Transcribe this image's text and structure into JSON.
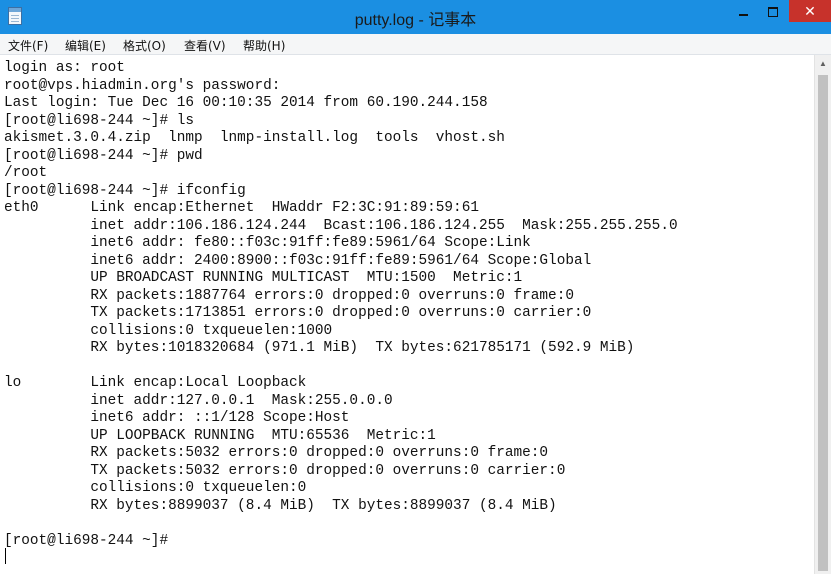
{
  "window": {
    "title": "putty.log - 记事本",
    "minimize_glyph": "",
    "maximize_glyph": "",
    "close_glyph": "✕",
    "accent_color": "#1b8fe2",
    "close_color": "#c7322b"
  },
  "menubar": {
    "items": [
      {
        "label": "文件(F)"
      },
      {
        "label": "编辑(E)"
      },
      {
        "label": "格式(O)"
      },
      {
        "label": "查看(V)"
      },
      {
        "label": "帮助(H)"
      }
    ]
  },
  "editor": {
    "lines": [
      "login as: root",
      "root@vps.hiadmin.org's password:",
      "Last login: Tue Dec 16 00:10:35 2014 from 60.190.244.158",
      "[root@li698-244 ~]# ls",
      "akismet.3.0.4.zip  lnmp  lnmp-install.log  tools  vhost.sh",
      "[root@li698-244 ~]# pwd",
      "/root",
      "[root@li698-244 ~]# ifconfig",
      "eth0      Link encap:Ethernet  HWaddr F2:3C:91:89:59:61",
      "          inet addr:106.186.124.244  Bcast:106.186.124.255  Mask:255.255.255.0",
      "          inet6 addr: fe80::f03c:91ff:fe89:5961/64 Scope:Link",
      "          inet6 addr: 2400:8900::f03c:91ff:fe89:5961/64 Scope:Global",
      "          UP BROADCAST RUNNING MULTICAST  MTU:1500  Metric:1",
      "          RX packets:1887764 errors:0 dropped:0 overruns:0 frame:0",
      "          TX packets:1713851 errors:0 dropped:0 overruns:0 carrier:0",
      "          collisions:0 txqueuelen:1000",
      "          RX bytes:1018320684 (971.1 MiB)  TX bytes:621785171 (592.9 MiB)",
      "",
      "lo        Link encap:Local Loopback",
      "          inet addr:127.0.0.1  Mask:255.0.0.0",
      "          inet6 addr: ::1/128 Scope:Host",
      "          UP LOOPBACK RUNNING  MTU:65536  Metric:1",
      "          RX packets:5032 errors:0 dropped:0 overruns:0 frame:0",
      "          TX packets:5032 errors:0 dropped:0 overruns:0 carrier:0",
      "          collisions:0 txqueuelen:0",
      "          RX bytes:8899037 (8.4 MiB)  TX bytes:8899037 (8.4 MiB)",
      "",
      "[root@li698-244 ~]#",
      ""
    ]
  },
  "scrollbar": {
    "up_glyph": "▲"
  }
}
